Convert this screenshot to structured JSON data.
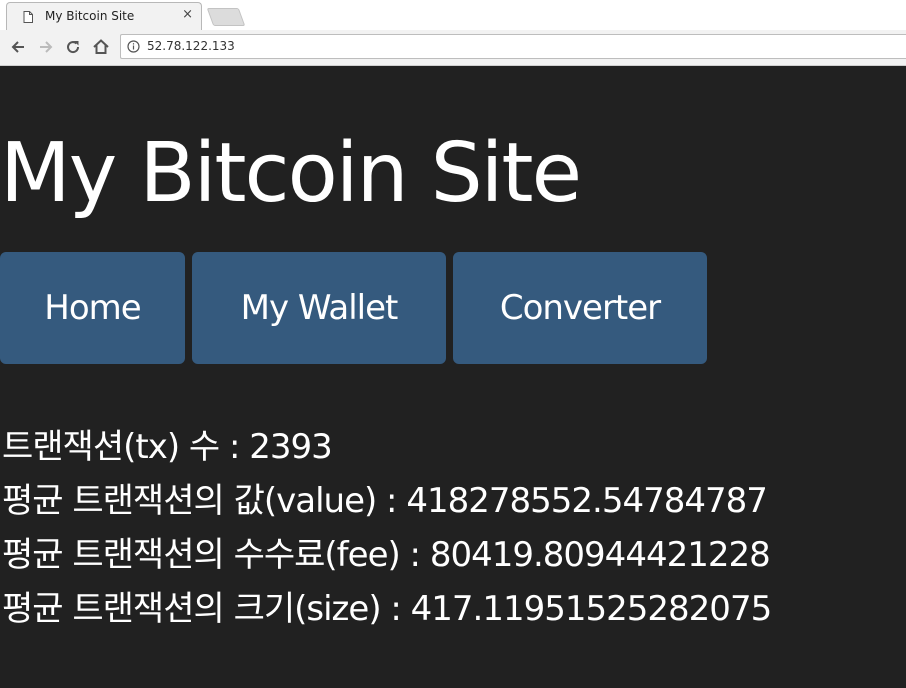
{
  "browser": {
    "tab_title": "My Bitcoin Site",
    "tab_close_glyph": "×",
    "url": "52.78.122.133",
    "icons": [
      "page-icon",
      "back-icon",
      "forward-icon",
      "reload-icon",
      "home-icon",
      "info-icon"
    ]
  },
  "site": {
    "title": "My Bitcoin Site",
    "nav": [
      {
        "label": "Home"
      },
      {
        "label": "My Wallet"
      },
      {
        "label": "Converter"
      }
    ],
    "accent_color": "#355a7e",
    "background_color": "#212121"
  },
  "stats": {
    "tx_count": "트랜잭션(tx) 수 : 2393",
    "avg_value": "평균 트랜잭션의 값(value) : 418278552.54784787",
    "avg_fee": "평균 트랜잭션의 수수료(fee) : 80419.80944421228",
    "avg_size": "평균 트랜잭션의 크기(size) : 417.11951525282075"
  }
}
